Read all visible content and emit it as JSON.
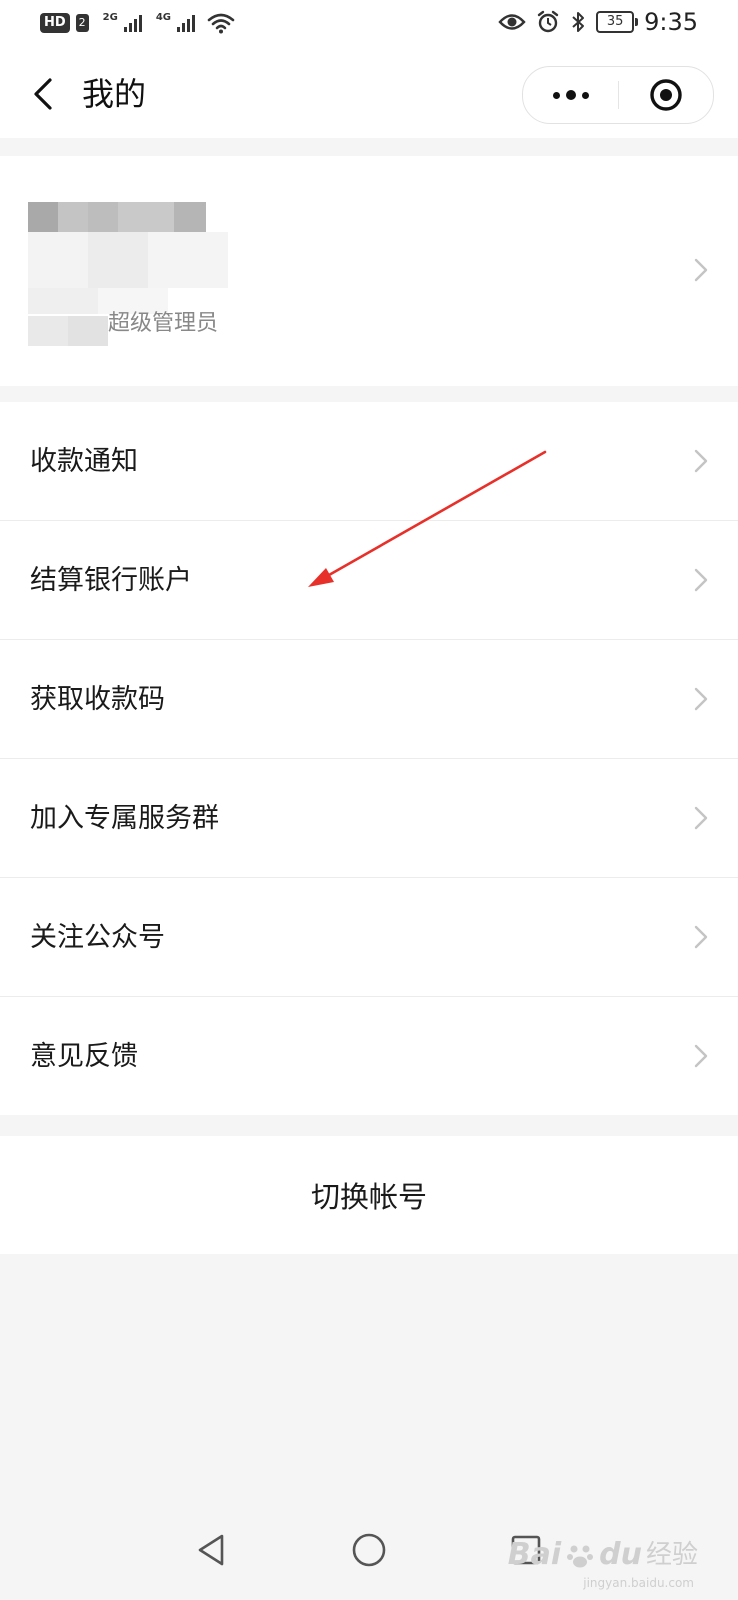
{
  "status_bar": {
    "hd_label": "HD",
    "sim_label": "2",
    "net1": "2G",
    "net2": "4G",
    "battery": "35",
    "time": "9:35"
  },
  "nav": {
    "title": "我的"
  },
  "profile": {
    "role": "超级管理员"
  },
  "menu": {
    "items": [
      {
        "label": "收款通知"
      },
      {
        "label": "结算银行账户"
      },
      {
        "label": "获取收款码"
      },
      {
        "label": "加入专属服务群"
      },
      {
        "label": "关注公众号"
      },
      {
        "label": "意见反馈"
      }
    ]
  },
  "switch_account": {
    "label": "切换帐号"
  },
  "watermark": {
    "brand": "Bai",
    "brand2": "du",
    "text": "经验",
    "url": "jingyan.baidu.com"
  },
  "colors": {
    "background": "#f5f5f5",
    "card": "#ffffff",
    "annotation_arrow": "#e8302a"
  }
}
